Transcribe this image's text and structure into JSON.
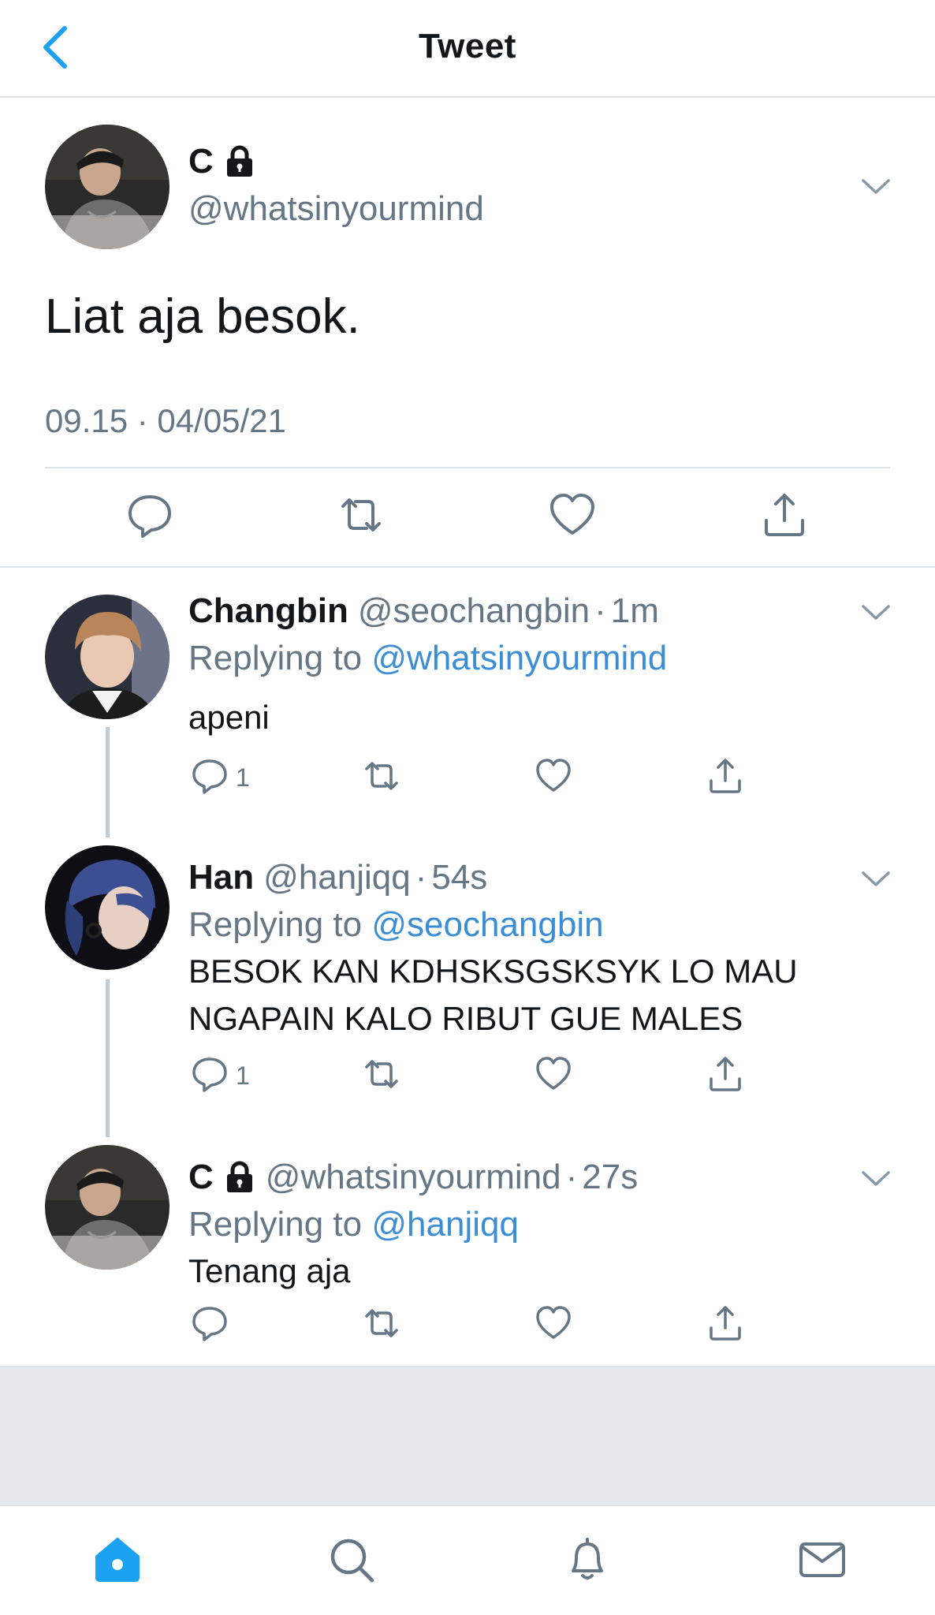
{
  "header": {
    "title": "Tweet"
  },
  "main_tweet": {
    "name": "C",
    "handle": "@whatsinyourmind",
    "text": "Liat aja besok.",
    "timestamp": "09.15 · 04/05/21"
  },
  "replies": [
    {
      "name": "Changbin",
      "handle": "@seochangbin",
      "dot": "·",
      "time": "1m",
      "replying_prefix": "Replying to",
      "replying_to": "@whatsinyourmind",
      "text": "apeni",
      "reply_count": "1"
    },
    {
      "name": "Han",
      "handle": "@hanjiqq",
      "dot": "·",
      "time": "54s",
      "replying_prefix": "Replying to",
      "replying_to": "@seochangbin",
      "text": "BESOK KAN KDHSKSGSKSYK LO MAU NGAPAIN KALO RIBUT GUE MALES",
      "reply_count": "1"
    },
    {
      "name": "C",
      "handle": "@whatsinyourmind",
      "dot": "·",
      "time": "27s",
      "replying_prefix": "Replying to",
      "replying_to": "@hanjiqq",
      "text": "Tenang aja",
      "reply_count": ""
    }
  ],
  "colors": {
    "accent": "#1da1f2",
    "link": "#3b8ed6",
    "muted": "#657786",
    "divider": "#dfe3e6"
  },
  "icons": [
    "back-chevron-icon",
    "lock-icon",
    "chevron-down-icon",
    "reply-icon",
    "retweet-icon",
    "like-icon",
    "share-icon",
    "home-icon",
    "search-icon",
    "notifications-icon",
    "messages-icon"
  ]
}
